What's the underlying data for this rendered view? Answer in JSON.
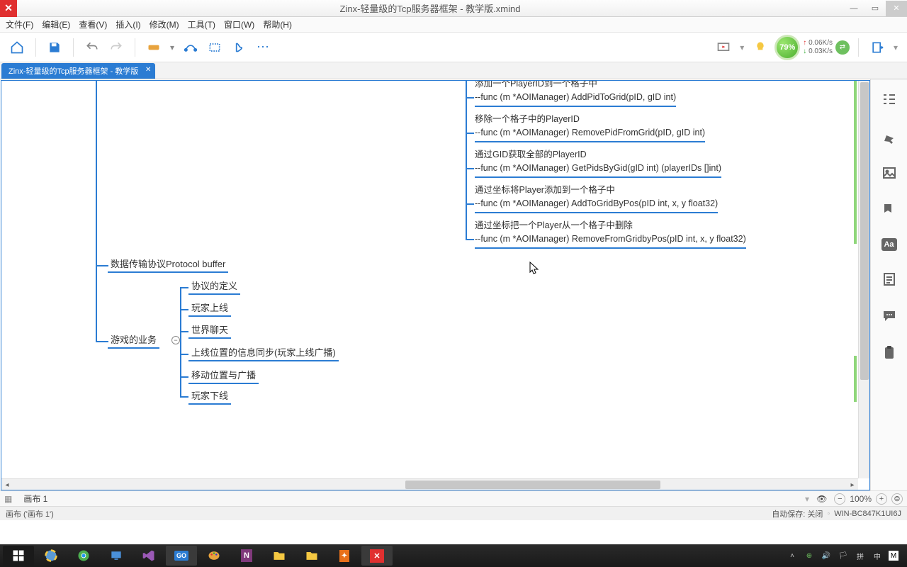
{
  "window": {
    "title": "Zinx-轻量级的Tcp服务器框架 - 教学版.xmind",
    "tab_title": "Zinx-轻量级的Tcp服务器框架 - 教学版"
  },
  "menu": {
    "file": "文件(F)",
    "edit": "编辑(E)",
    "view": "查看(V)",
    "insert": "插入(I)",
    "modify": "修改(M)",
    "tools": "工具(T)",
    "window": "窗口(W)",
    "help": "帮助(H)"
  },
  "netmon": {
    "percent": "79%",
    "up": "0.06K/s",
    "down": "0.03K/s"
  },
  "mindmap": {
    "protocol": "数据传输协议Protocol buffer",
    "business": "游戏的业务",
    "biz_children": {
      "c1": "协议的定义",
      "c2": "玩家上线",
      "c3": "世界聊天",
      "c4": "上线位置的信息同步(玩家上线广播)",
      "c5": "移动位置与广播",
      "c6": "玩家下线"
    },
    "funcs": {
      "f0a": "添加一个PlayerID到一个格子中",
      "f0b": "--func (m *AOIManager) AddPidToGrid(pID, gID int)",
      "f1a": "移除一个格子中的PlayerID",
      "f1b": "--func (m *AOIManager) RemovePidFromGrid(pID, gID int)",
      "f2a": "通过GID获取全部的PlayerID",
      "f2b": "--func (m *AOIManager) GetPidsByGid(gID int) (playerIDs []int)",
      "f3a": "通过坐标将Player添加到一个格子中",
      "f3b": "--func (m *AOIManager) AddToGridByPos(pID int, x, y float32)",
      "f4a": "通过坐标把一个Player从一个格子中删除",
      "f4b": "--func (m *AOIManager) RemoveFromGridbyPos(pID int, x, y float32)"
    }
  },
  "sheet": {
    "name": "画布 1",
    "zoom": "100%"
  },
  "status": {
    "left": "画布 ('画布 1')",
    "autosave": "自动保存: 关闭",
    "host": "WIN-BC847K1UI6J"
  },
  "colors": {
    "accent": "#2b7cd3"
  }
}
